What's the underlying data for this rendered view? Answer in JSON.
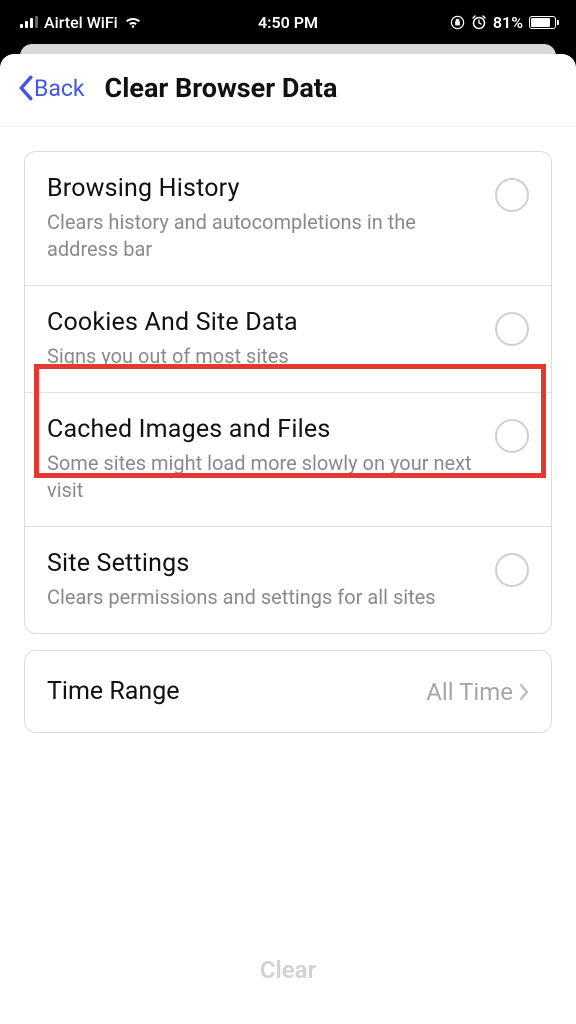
{
  "status": {
    "carrier": "Airtel WiFi",
    "time": "4:50 PM",
    "battery": "81%"
  },
  "nav": {
    "back_label": "Back",
    "title": "Clear Browser Data"
  },
  "options": [
    {
      "title": "Browsing History",
      "desc": "Clears history and autocompletions in the address bar"
    },
    {
      "title": "Cookies And Site Data",
      "desc": "Signs you out of most sites"
    },
    {
      "title": "Cached Images and Files",
      "desc": "Some sites might load more slowly on your next visit"
    },
    {
      "title": "Site Settings",
      "desc": "Clears permissions and settings for all sites"
    }
  ],
  "time_range": {
    "label": "Time Range",
    "value": "All Time"
  },
  "footer": {
    "clear_label": "Clear"
  }
}
